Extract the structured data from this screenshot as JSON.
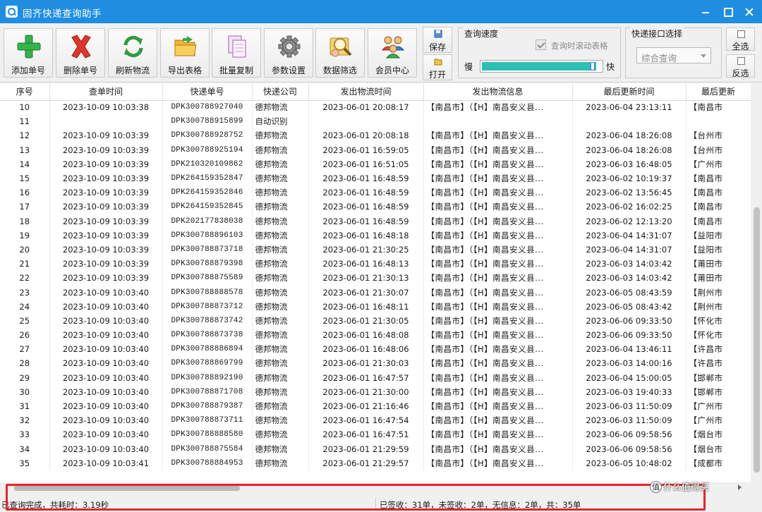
{
  "window": {
    "title": "固齐快递查询助手"
  },
  "toolbar": {
    "buttons": [
      {
        "label": "添加单号",
        "icon": "plus-icon"
      },
      {
        "label": "删除单号",
        "icon": "delete-x-icon"
      },
      {
        "label": "刷新物流",
        "icon": "refresh-icon"
      },
      {
        "label": "导出表格",
        "icon": "folder-export-icon"
      },
      {
        "label": "批量复制",
        "icon": "copy-pages-icon"
      },
      {
        "label": "参数设置",
        "icon": "gear-icon"
      },
      {
        "label": "数据筛选",
        "icon": "filter-search-icon"
      },
      {
        "label": "会员中心",
        "icon": "users-icon"
      }
    ],
    "save_label": "保存",
    "open_label": "打开",
    "speed_title": "查询速度",
    "scroll_table_label": "查询时滚动表格",
    "slow_label": "慢",
    "fast_label": "快",
    "speed_level": 0.95,
    "interface_title": "快递接口选择",
    "interface_value": "综合查询",
    "select_all_label": "全选",
    "invert_label": "反选"
  },
  "table": {
    "columns": [
      "序号",
      "查单时间",
      "快递单号",
      "快递公司",
      "发出物流时间",
      "发出物流信息",
      "最后更新时间",
      "最后更新"
    ],
    "rows": [
      [
        "10",
        "2023-10-09 10:03:38",
        "DPK300788927040",
        "德邦物流",
        "2023-06-01 20:08:17",
        "【南昌市】（【H】南昌安义县...",
        "2023-06-04 23:13:11",
        "【南昌市"
      ],
      [
        "11",
        "",
        "DPK300788915899",
        "自动识别",
        "",
        "",
        "",
        ""
      ],
      [
        "12",
        "2023-10-09 10:03:39",
        "DPK300788928752",
        "德邦物流",
        "2023-06-01 20:08:18",
        "【南昌市】（【H】南昌安义县...",
        "2023-06-04 18:26:08",
        "【台州市"
      ],
      [
        "13",
        "2023-10-09 10:03:39",
        "DPK300788925194",
        "德邦物流",
        "2023-06-01 16:59:05",
        "【南昌市】（【H】南昌安义县...",
        "2023-06-04 18:26:08",
        "【台州市"
      ],
      [
        "14",
        "2023-10-09 10:03:39",
        "DPK210320109862",
        "德邦物流",
        "2023-06-01 16:51:05",
        "【南昌市】（【H】南昌安义县...",
        "2023-06-03 16:48:05",
        "【广州市"
      ],
      [
        "15",
        "2023-10-09 10:03:39",
        "DPK264159352847",
        "德邦物流",
        "2023-06-01 16:48:59",
        "【南昌市】（【H】南昌安义县...",
        "2023-06-02 10:19:37",
        "【南昌市"
      ],
      [
        "16",
        "2023-10-09 10:03:39",
        "DPK264159352846",
        "德邦物流",
        "2023-06-01 16:48:59",
        "【南昌市】（【H】南昌安义县...",
        "2023-06-02 13:56:45",
        "【南昌市"
      ],
      [
        "17",
        "2023-10-09 10:03:39",
        "DPK264159352845",
        "德邦物流",
        "2023-06-01 16:48:59",
        "【南昌市】（【H】南昌安义县...",
        "2023-06-02 16:02:25",
        "【南昌市"
      ],
      [
        "18",
        "2023-10-09 10:03:39",
        "DPK202177838038",
        "德邦物流",
        "2023-06-01 16:48:59",
        "【南昌市】（【H】南昌安义县...",
        "2023-06-02 12:13:20",
        "【南昌市"
      ],
      [
        "19",
        "2023-10-09 10:03:39",
        "DPK300788896103",
        "德邦物流",
        "2023-06-01 16:48:18",
        "【南昌市】（【H】南昌安义县...",
        "2023-06-04 14:31:07",
        "【益阳市"
      ],
      [
        "20",
        "2023-10-09 10:03:39",
        "DPK300788873718",
        "德邦物流",
        "2023-06-01 21:30:25",
        "【南昌市】（【H】南昌安义县...",
        "2023-06-04 14:31:07",
        "【益阳市"
      ],
      [
        "21",
        "2023-10-09 10:03:39",
        "DPK300788879398",
        "德邦物流",
        "2023-06-01 16:48:13",
        "【南昌市】（【H】南昌安义县...",
        "2023-06-03 14:03:42",
        "【莆田市"
      ],
      [
        "22",
        "2023-10-09 10:03:39",
        "DPK300788875589",
        "德邦物流",
        "2023-06-01 21:30:13",
        "【南昌市】（【H】南昌安义县...",
        "2023-06-03 14:03:42",
        "【莆田市"
      ],
      [
        "23",
        "2023-10-09 10:03:40",
        "DPK300788888578",
        "德邦物流",
        "2023-06-01 21:30:07",
        "【南昌市】（【H】南昌安义县...",
        "2023-06-05 08:43:59",
        "【荆州市"
      ],
      [
        "24",
        "2023-10-09 10:03:40",
        "DPK300788873712",
        "德邦物流",
        "2023-06-01 16:48:11",
        "【南昌市】（【H】南昌安义县...",
        "2023-06-05 08:43:42",
        "【荆州市"
      ],
      [
        "25",
        "2023-10-09 10:03:40",
        "DPK300788873742",
        "德邦物流",
        "2023-06-01 21:30:05",
        "【南昌市】（【H】南昌安义县...",
        "2023-06-06 09:33:50",
        "【怀化市"
      ],
      [
        "26",
        "2023-10-09 10:03:40",
        "DPK300788873738",
        "德邦物流",
        "2023-06-01 16:48:08",
        "【南昌市】（【H】南昌安义县...",
        "2023-06-06 09:33:50",
        "【怀化市"
      ],
      [
        "27",
        "2023-10-09 10:03:40",
        "DPK300788886894",
        "德邦物流",
        "2023-06-01 16:48:06",
        "【南昌市】（【H】南昌安义县...",
        "2023-06-04 13:46:11",
        "【许昌市"
      ],
      [
        "28",
        "2023-10-09 10:03:40",
        "DPK300788869799",
        "德邦物流",
        "2023-06-01 21:30:03",
        "【南昌市】（【H】南昌安义县...",
        "2023-06-03 14:00:16",
        "【许昌市"
      ],
      [
        "29",
        "2023-10-09 10:03:40",
        "DPK300788892190",
        "德邦物流",
        "2023-06-01 16:47:57",
        "【南昌市】（【H】南昌安义县...",
        "2023-06-04 15:00:05",
        "【邯郸市"
      ],
      [
        "30",
        "2023-10-09 10:03:40",
        "DPK300788871708",
        "德邦物流",
        "2023-06-01 21:30:00",
        "【南昌市】（【H】南昌安义县...",
        "2023-06-03 19:40:33",
        "【邯郸市"
      ],
      [
        "31",
        "2023-10-09 10:03:40",
        "DPK300788879387",
        "德邦物流",
        "2023-06-01 21:16:46",
        "【南昌市】（【H】南昌安义县...",
        "2023-06-03 11:50:09",
        "【广州市"
      ],
      [
        "32",
        "2023-10-09 10:03:40",
        "DPK300788873711",
        "德邦物流",
        "2023-06-01 16:47:54",
        "【南昌市】（【H】南昌安义县...",
        "2023-06-03 11:50:09",
        "【广州市"
      ],
      [
        "33",
        "2023-10-09 10:03:40",
        "DPK300788888580",
        "德邦物流",
        "2023-06-01 16:47:51",
        "【南昌市】（【H】南昌安义县...",
        "2023-06-06 09:58:56",
        "【烟台市"
      ],
      [
        "34",
        "2023-10-09 10:03:40",
        "DPK300788875584",
        "德邦物流",
        "2023-06-01 21:29:59",
        "【南昌市】（【H】南昌安义县...",
        "2023-06-06 09:58:56",
        "【烟台市"
      ],
      [
        "35",
        "2023-10-09 10:03:41",
        "DPK300788884953",
        "德邦物流",
        "2023-06-01 21:29:57",
        "【南昌市】（【H】南昌安义县...",
        "2023-06-05 10:48:02",
        "【成都市"
      ]
    ]
  },
  "status": {
    "left": "已查询完成，共耗时：3.19秒",
    "right": "已签收：31单，未签收：2单，无信息：2单，共：35单"
  },
  "watermark": {
    "badge": "值",
    "text": "什么值得买"
  },
  "colors": {
    "titlebar": "#1f8ee0",
    "slider_fill": "#2dbfb3",
    "highlight": "#e8232b"
  }
}
